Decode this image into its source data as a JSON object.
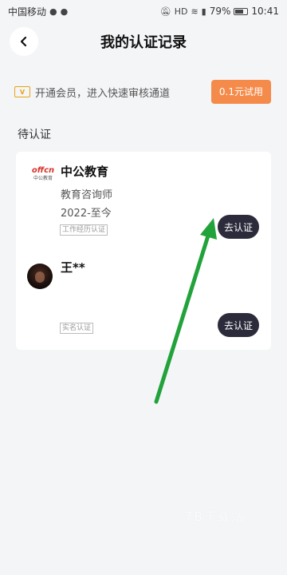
{
  "status_bar": {
    "carrier": "中国移动",
    "battery": "79%",
    "time": "10:41"
  },
  "header": {
    "title": "我的认证记录"
  },
  "vip_banner": {
    "text": "开通会员，进入快速审核通道",
    "button_label": "0.1元试用"
  },
  "section": {
    "title": "待认证"
  },
  "records": [
    {
      "logo_text": "offcn",
      "logo_subtext": "中公教育",
      "name": "中公教育",
      "position": "教育咨询师",
      "period": "2022-至今",
      "tag": "工作经历认证",
      "button_label": "去认证"
    },
    {
      "name": "王**",
      "tag": "实名认证",
      "button_label": "去认证"
    }
  ],
  "watermark": "7B下载站",
  "colors": {
    "background": "#f4f5f7",
    "vip_button": "#f58b4b",
    "verify_button": "#2c2b3b",
    "arrow": "#22a23a",
    "vip_icon": "#e8a317"
  }
}
